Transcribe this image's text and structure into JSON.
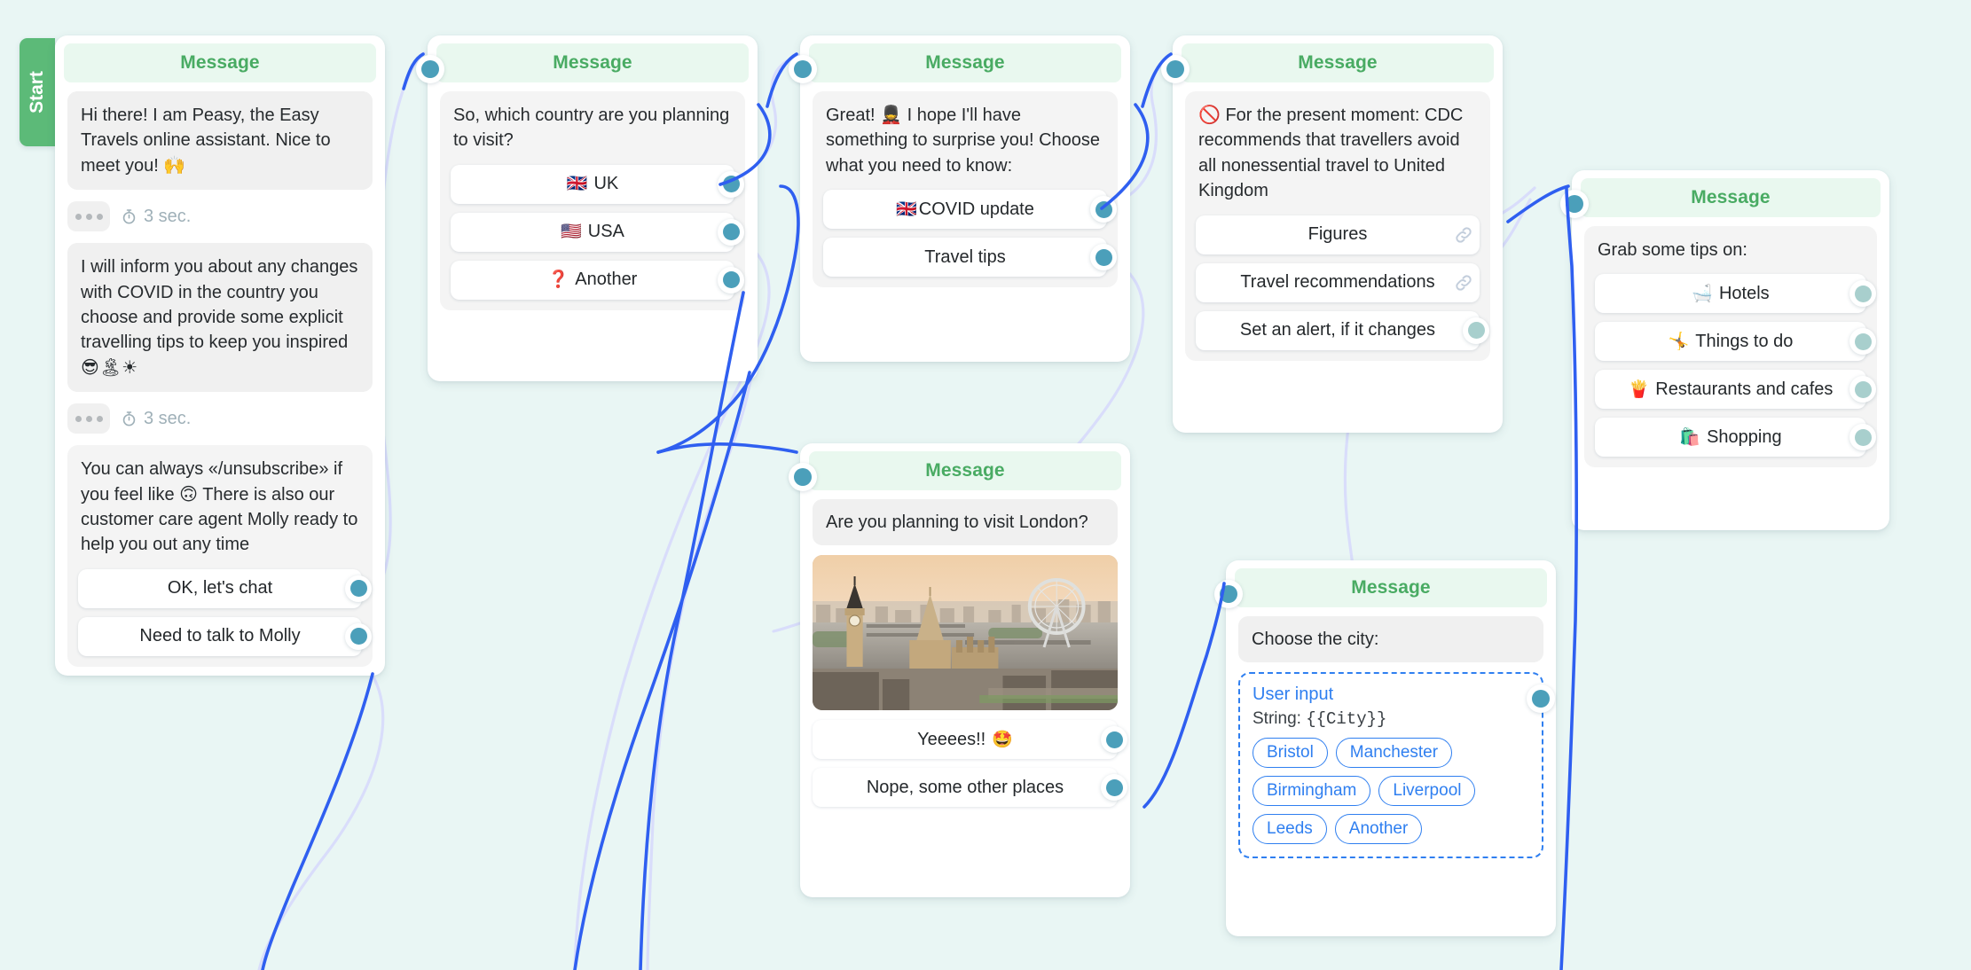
{
  "canvas": {
    "background_color": "#e9f6f4",
    "edge_color": "#2f5ff0",
    "edge_color_behind": "#d8dcfb",
    "port_color": "#4b9fba",
    "port_color_muted": "#a8cfcd",
    "header_color": "#49ab63",
    "start_tab_color": "#5cba78",
    "chip_color": "#2f7ff0"
  },
  "start_tab": {
    "label": "Start"
  },
  "node_title": "Message",
  "delay": {
    "label": "3 sec.",
    "icon": "timer-icon",
    "typing_icon": "typing-dots-icon"
  },
  "nodes": [
    {
      "id": "welcome",
      "title": "Message",
      "bubbles": [
        "Hi there! I am Peasy, the Easy Travels online assistant. Nice to meet you! 🙌",
        "I will inform you about any changes with COVID in the country you choose and provide some explicit travelling tips to keep you inspired 😎🏝☀",
        "You can always «/unsubscribe» if you feel like 🙃 There is also our customer care agent Molly ready to help you out any time"
      ],
      "delays": [
        "3 sec.",
        "3 sec."
      ],
      "buttons": [
        {
          "emoji": "",
          "label": "OK, let's chat",
          "port": "active"
        },
        {
          "emoji": "",
          "label": "Need to talk to Molly",
          "port": "active"
        }
      ]
    },
    {
      "id": "country",
      "title": "Message",
      "prompt": "So, which country are you planning to visit?",
      "buttons": [
        {
          "emoji": "🇬🇧",
          "label": "UK",
          "port": "active"
        },
        {
          "emoji": "🇺🇸",
          "label": "USA",
          "port": "active"
        },
        {
          "emoji": "❓",
          "label": "Another",
          "port": "active"
        }
      ]
    },
    {
      "id": "choose",
      "title": "Message",
      "prompt": "Great! 💂 I hope I'll have something to surprise you! Choose what you need to know:",
      "buttons": [
        {
          "emoji": "🇬🇧",
          "label": "COVID update",
          "port": "active"
        },
        {
          "emoji": "",
          "label": "Travel tips",
          "port": "active"
        }
      ]
    },
    {
      "id": "cdc",
      "title": "Message",
      "prompt": "🚫 For the present moment: CDC recommends that travellers avoid all nonessential travel to United Kingdom",
      "buttons": [
        {
          "emoji": "",
          "label": "Figures",
          "port": "link"
        },
        {
          "emoji": "",
          "label": "Travel recommendations",
          "port": "link"
        },
        {
          "emoji": "",
          "label": "Set an alert, if it changes",
          "port": "muted"
        }
      ]
    },
    {
      "id": "tips",
      "title": "Message",
      "prompt": "Grab some tips on:",
      "buttons": [
        {
          "emoji": "🛁",
          "label": "Hotels",
          "port": "muted"
        },
        {
          "emoji": "🤸",
          "label": "Things to do",
          "port": "muted"
        },
        {
          "emoji": "🍟",
          "label": "Restaurants and cafes",
          "port": "muted"
        },
        {
          "emoji": "🛍️",
          "label": "Shopping",
          "port": "muted"
        }
      ]
    },
    {
      "id": "london",
      "title": "Message",
      "prompt": "Are you planning to visit London?",
      "image_alt": "london-skyline-photo",
      "buttons": [
        {
          "emoji": "🤩",
          "label": "Yeeees!!",
          "emoji_after": true,
          "port": "active"
        },
        {
          "emoji": "",
          "label": "Nope, some other places",
          "port": "active"
        }
      ]
    },
    {
      "id": "city",
      "title": "Message",
      "prompt": "Choose the city:",
      "user_input": {
        "title": "User input",
        "type_label": "String:",
        "variable": "{{City}}",
        "chips": [
          "Bristol",
          "Manchester",
          "Birmingham",
          "Liverpool",
          "Leeds",
          "Another"
        ]
      }
    }
  ]
}
